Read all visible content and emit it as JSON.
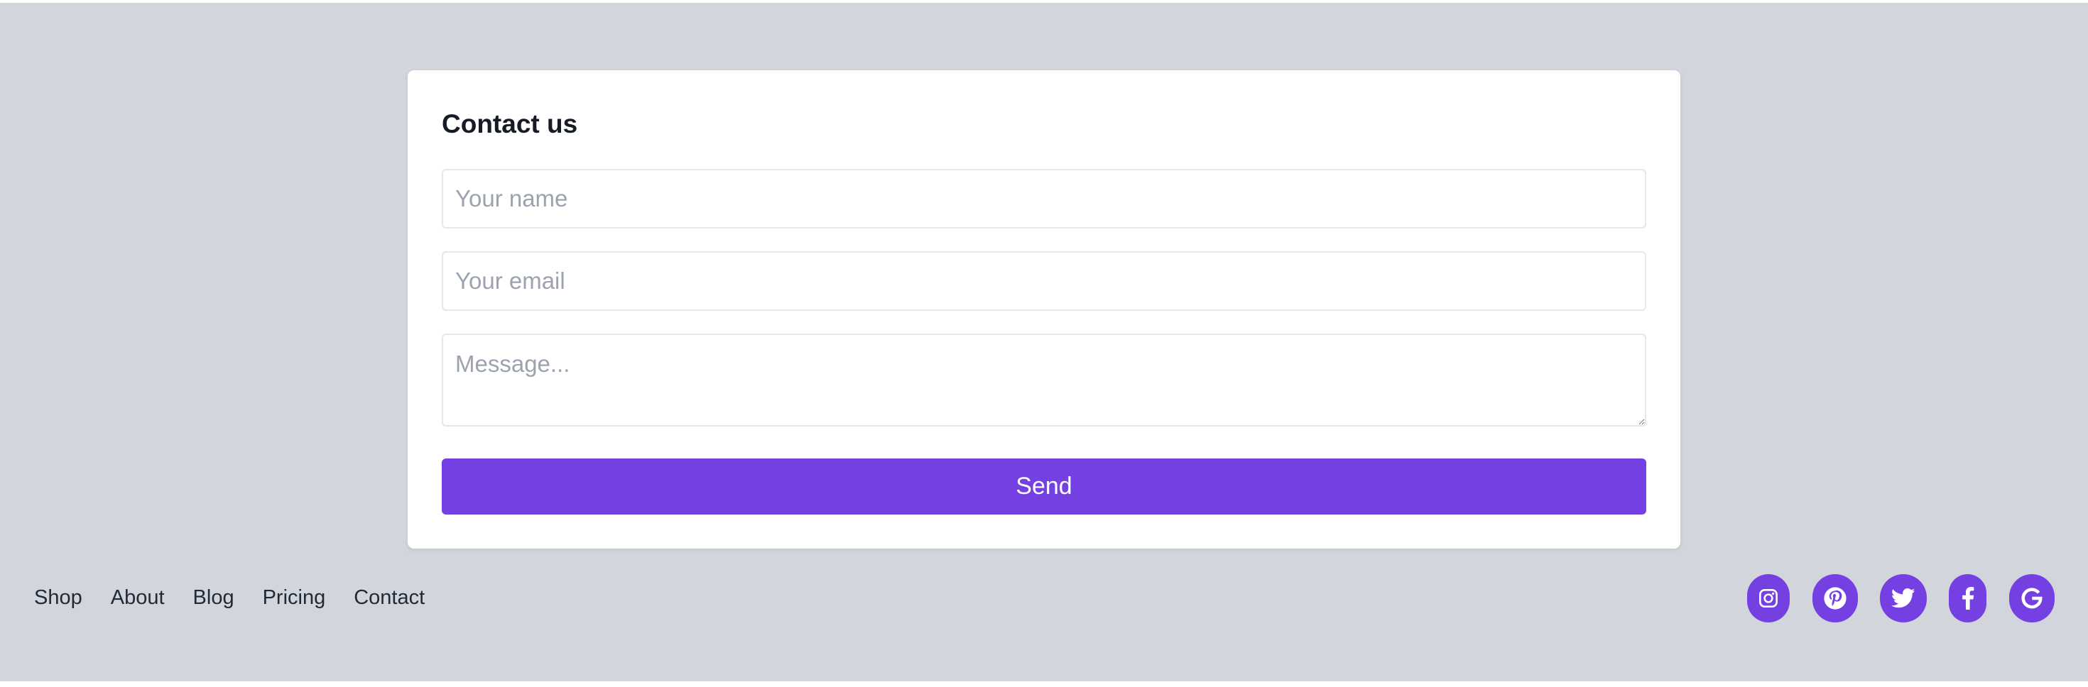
{
  "contact_form": {
    "title": "Contact us",
    "name_placeholder": "Your name",
    "email_placeholder": "Your email",
    "message_placeholder": "Message...",
    "send_label": "Send"
  },
  "footer": {
    "nav_links": [
      "Shop",
      "About",
      "Blog",
      "Pricing",
      "Contact"
    ],
    "social_icons": [
      "instagram-icon",
      "pinterest-icon",
      "twitter-icon",
      "facebook-icon",
      "google-icon"
    ]
  },
  "colors": {
    "accent": "#7540e2",
    "background": "#d2d5db",
    "card": "#ffffff",
    "text": "#1f2937",
    "placeholder": "#9ca3af",
    "input_border": "#e5e7eb"
  }
}
